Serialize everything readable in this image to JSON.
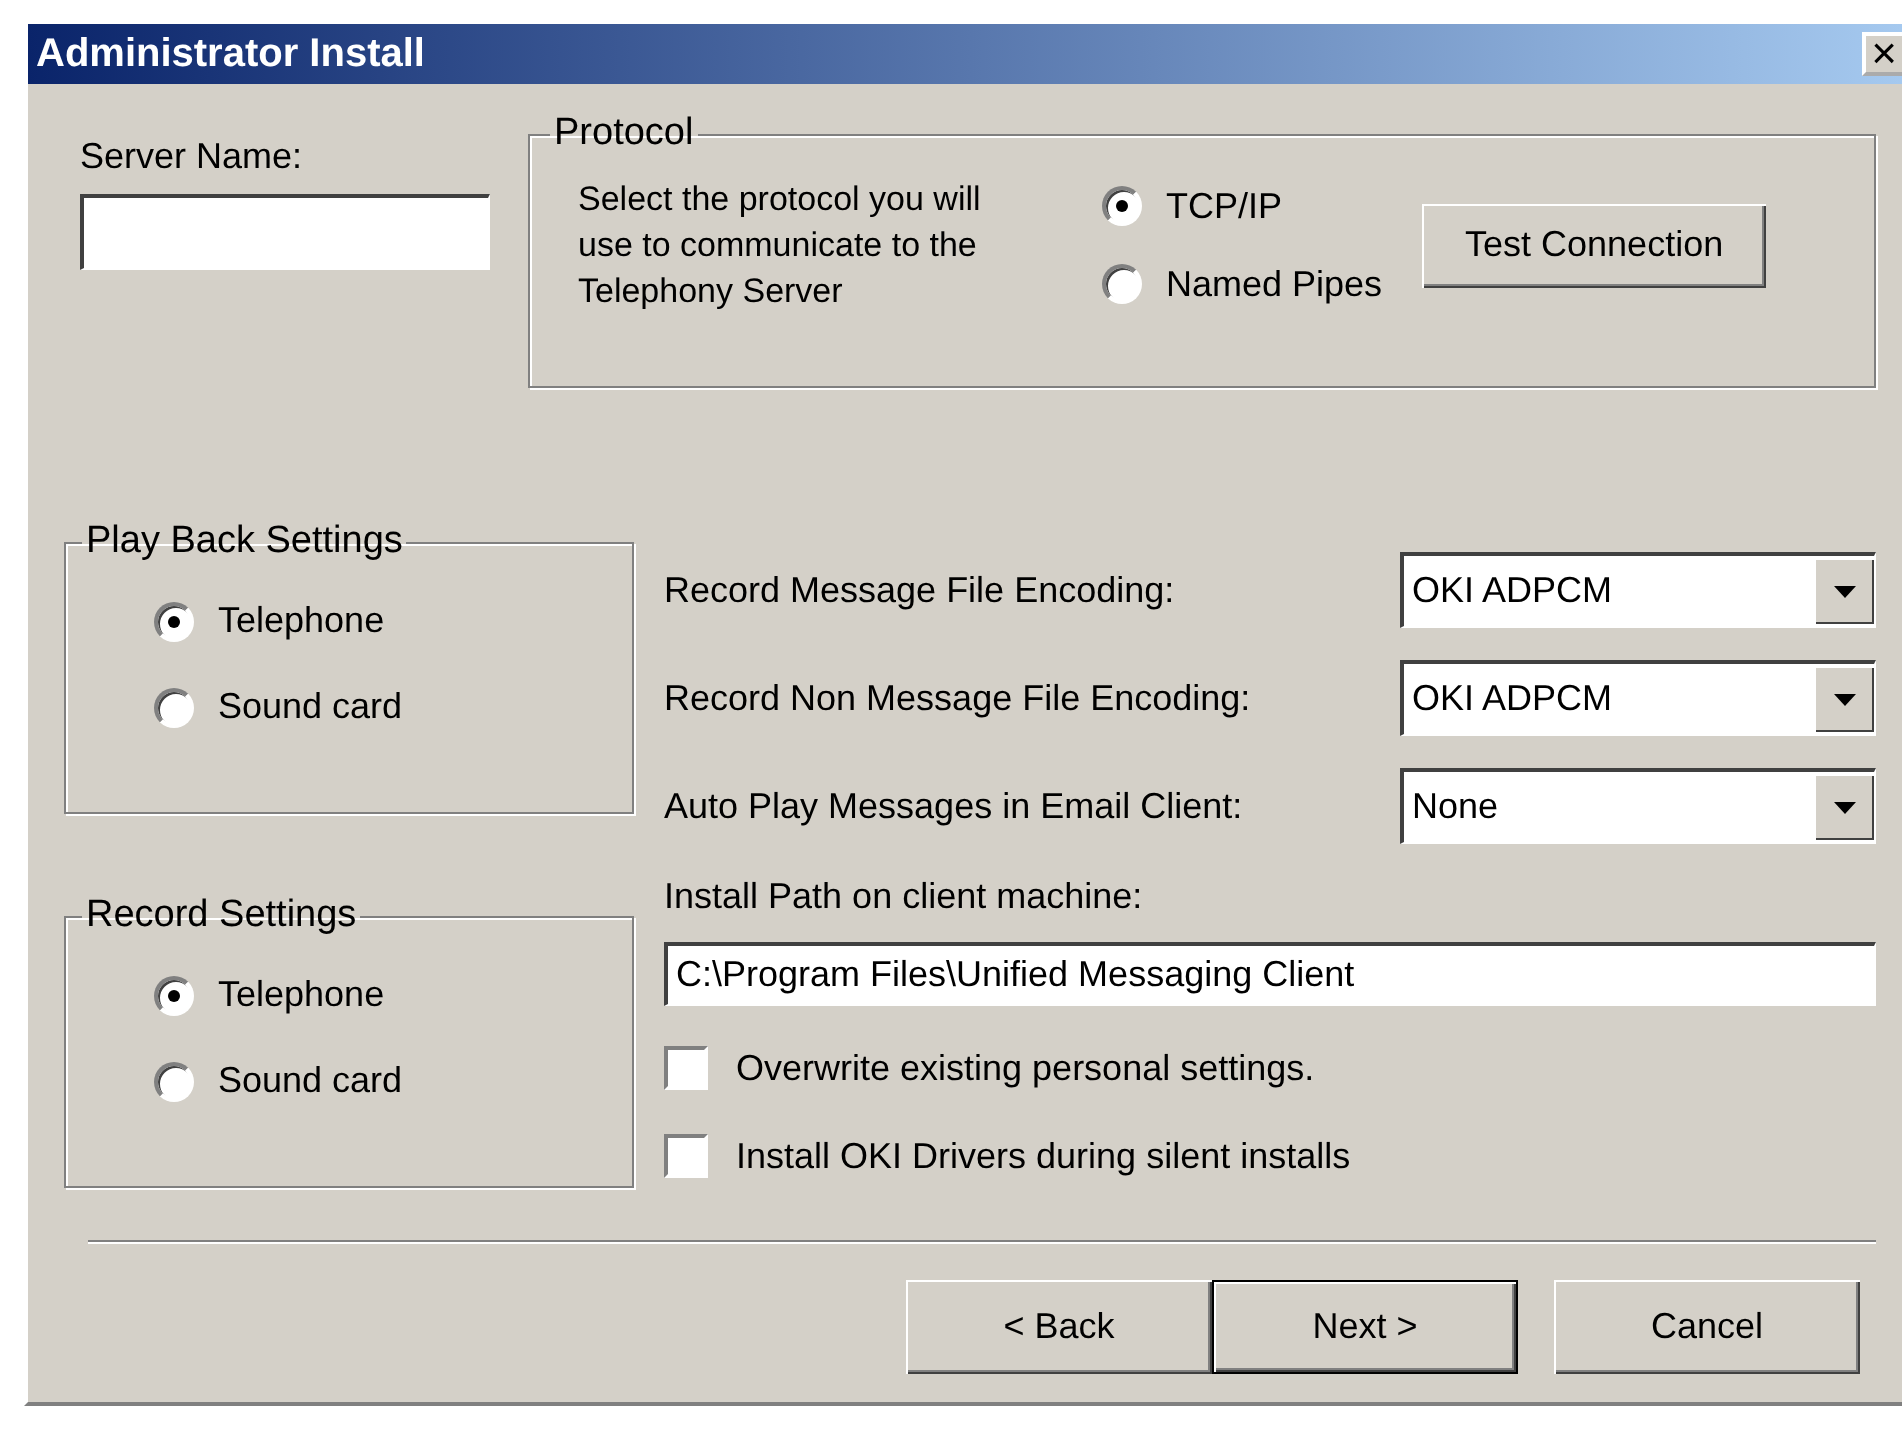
{
  "window": {
    "title": "Administrator Install",
    "close": "×"
  },
  "server_name": {
    "label": "Server Name:"
  },
  "protocol": {
    "title": "Protocol",
    "description": "Select the protocol you will use to communicate to the Telephony Server",
    "options": [
      {
        "label": "TCP/IP",
        "selected": true
      },
      {
        "label": "Named Pipes",
        "selected": false
      }
    ],
    "test_button": "Test Connection"
  },
  "playback_settings": {
    "title": "Play Back Settings",
    "options": [
      {
        "label": "Telephone",
        "selected": true
      },
      {
        "label": "Sound card",
        "selected": false
      }
    ]
  },
  "record_settings": {
    "title": "Record Settings",
    "options": [
      {
        "label": "Telephone",
        "selected": true
      },
      {
        "label": "Sound card",
        "selected": false
      }
    ]
  },
  "settings": [
    {
      "kind": "select",
      "label": "Record Message File Encoding:",
      "value": "OKI ADPCM"
    },
    {
      "kind": "select",
      "label": "Record Non Message File Encoding:",
      "value": "OKI ADPCM"
    },
    {
      "kind": "select",
      "label": "Auto Play Messages in Email Client:",
      "value": "None"
    },
    {
      "kind": "text",
      "label": "Install Path on client machine:",
      "value": "C:\\Program Files\\Unified Messaging Client"
    }
  ],
  "checkboxes": [
    {
      "label": "Overwrite existing personal settings.",
      "checked": false
    },
    {
      "label": "Install OKI Drivers during silent installs",
      "checked": false
    }
  ],
  "buttons": [
    {
      "label": "< Back",
      "default": false
    },
    {
      "label": "Next >",
      "default": true
    },
    {
      "label": "Cancel",
      "default": false
    }
  ]
}
